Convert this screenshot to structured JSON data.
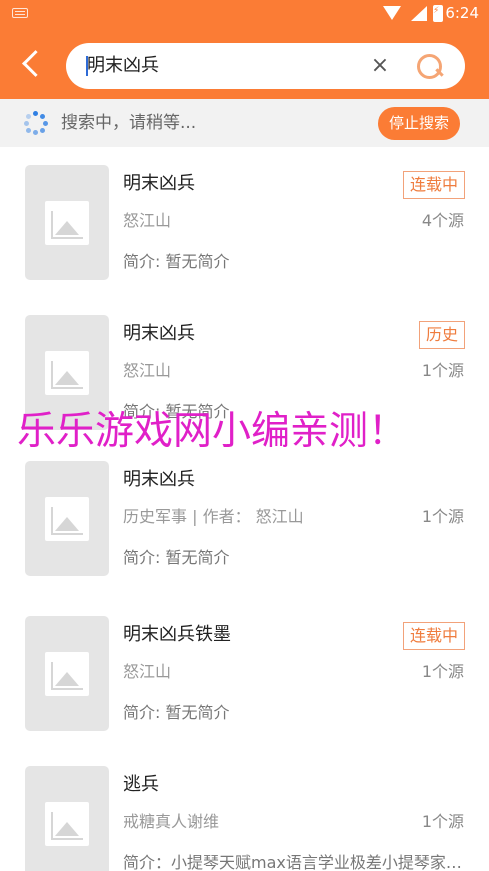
{
  "status_bar": {
    "time": "6:24"
  },
  "search": {
    "query": "明末凶兵",
    "clear_icon": "×"
  },
  "searching": {
    "message": "搜索中，请稍等...",
    "stop_label": "停止搜索"
  },
  "results": [
    {
      "title": "明末凶兵",
      "author": "怒江山",
      "sources": "4个源",
      "intro": "简介: 暂无简介",
      "tag": "连载中"
    },
    {
      "title": "明末凶兵",
      "author": "怒江山",
      "sources": "1个源",
      "intro": "简介: 暂无简介",
      "tag": "历史"
    },
    {
      "title": "明末凶兵",
      "author": "历史军事 | 作者： 怒江山",
      "sources": "1个源",
      "intro": "简介: 暂无简介",
      "tag": ""
    },
    {
      "title": "明末凶兵铁墨",
      "author": "怒江山",
      "sources": "1个源",
      "intro": "简介: 暂无简介",
      "tag": "连载中"
    },
    {
      "title": "逃兵",
      "author": "戒糖真人谢维",
      "sources": "1个源",
      "intro": "简介：小提琴天赋max语言学业极差小提琴家…",
      "tag": ""
    }
  ],
  "watermark": "乐乐游戏网小编亲测！",
  "colors": {
    "accent": "#fb7c35",
    "tag_border": "#f2a27a",
    "spinner": "#2f7fe3",
    "watermark": "#e020c8"
  }
}
